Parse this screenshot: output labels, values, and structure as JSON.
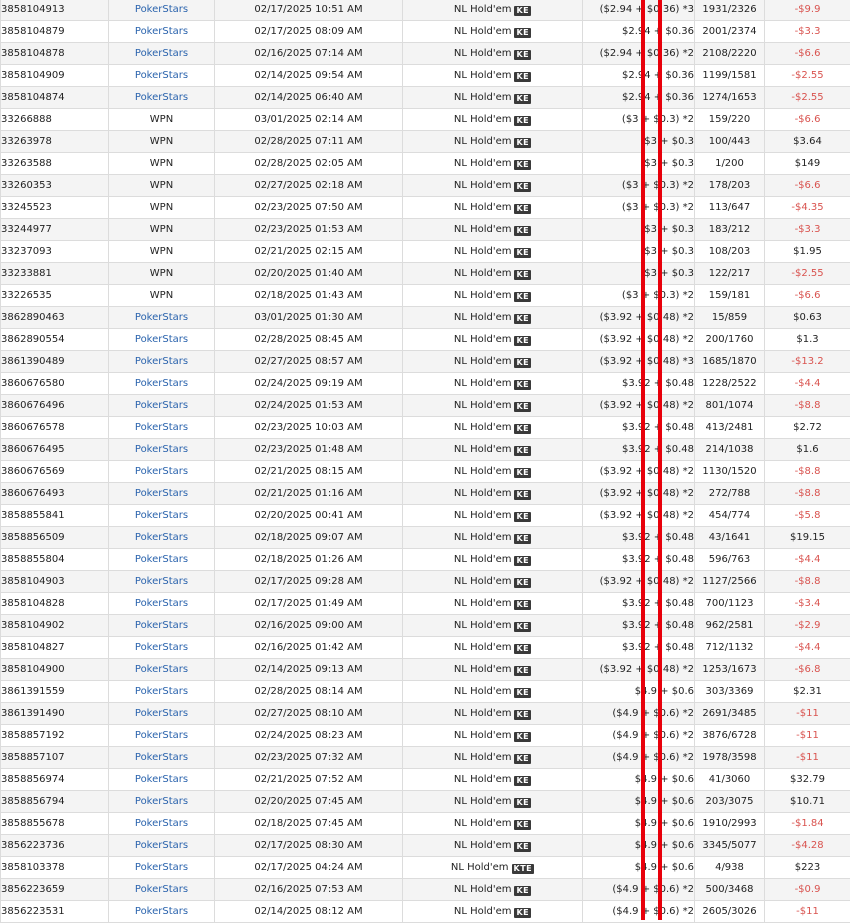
{
  "colors": {
    "site_link": "#2a63ad",
    "negative": "#d9534f",
    "marker": "#e8000b",
    "row_alt": "#f4f4f4",
    "badge_bg": "#3a3a3a"
  },
  "rows": [
    {
      "id": "3858104913",
      "site": "PokerStars",
      "date": "02/17/2025 10:51 AM",
      "game": "NL Hold'em",
      "badge": "KE",
      "buyin": "($2.94 + $0.36) *3",
      "place": "1931/2326",
      "result": "-$9.9",
      "neg": true
    },
    {
      "id": "3858104879",
      "site": "PokerStars",
      "date": "02/17/2025 08:09 AM",
      "game": "NL Hold'em",
      "badge": "KE",
      "buyin": "$2.94 + $0.36",
      "place": "2001/2374",
      "result": "-$3.3",
      "neg": true
    },
    {
      "id": "3858104878",
      "site": "PokerStars",
      "date": "02/16/2025 07:14 AM",
      "game": "NL Hold'em",
      "badge": "KE",
      "buyin": "($2.94 + $0.36) *2",
      "place": "2108/2220",
      "result": "-$6.6",
      "neg": true
    },
    {
      "id": "3858104909",
      "site": "PokerStars",
      "date": "02/14/2025 09:54 AM",
      "game": "NL Hold'em",
      "badge": "KE",
      "buyin": "$2.94 + $0.36",
      "place": "1199/1581",
      "result": "-$2.55",
      "neg": true
    },
    {
      "id": "3858104874",
      "site": "PokerStars",
      "date": "02/14/2025 06:40 AM",
      "game": "NL Hold'em",
      "badge": "KE",
      "buyin": "$2.94 + $0.36",
      "place": "1274/1653",
      "result": "-$2.55",
      "neg": true
    },
    {
      "id": "33266888",
      "site": "WPN",
      "date": "03/01/2025 02:14 AM",
      "game": "NL Hold'em",
      "badge": "KE",
      "buyin": "($3 + $0.3) *2",
      "place": "159/220",
      "result": "-$6.6",
      "neg": true
    },
    {
      "id": "33263978",
      "site": "WPN",
      "date": "02/28/2025 07:11 AM",
      "game": "NL Hold'em",
      "badge": "KE",
      "buyin": "$3 + $0.3",
      "place": "100/443",
      "result": "$3.64",
      "neg": false
    },
    {
      "id": "33263588",
      "site": "WPN",
      "date": "02/28/2025 02:05 AM",
      "game": "NL Hold'em",
      "badge": "KE",
      "buyin": "$3 + $0.3",
      "place": "1/200",
      "result": "$149",
      "neg": false
    },
    {
      "id": "33260353",
      "site": "WPN",
      "date": "02/27/2025 02:18 AM",
      "game": "NL Hold'em",
      "badge": "KE",
      "buyin": "($3 + $0.3) *2",
      "place": "178/203",
      "result": "-$6.6",
      "neg": true
    },
    {
      "id": "33245523",
      "site": "WPN",
      "date": "02/23/2025 07:50 AM",
      "game": "NL Hold'em",
      "badge": "KE",
      "buyin": "($3 + $0.3) *2",
      "place": "113/647",
      "result": "-$4.35",
      "neg": true
    },
    {
      "id": "33244977",
      "site": "WPN",
      "date": "02/23/2025 01:53 AM",
      "game": "NL Hold'em",
      "badge": "KE",
      "buyin": "$3 + $0.3",
      "place": "183/212",
      "result": "-$3.3",
      "neg": true
    },
    {
      "id": "33237093",
      "site": "WPN",
      "date": "02/21/2025 02:15 AM",
      "game": "NL Hold'em",
      "badge": "KE",
      "buyin": "$3 + $0.3",
      "place": "108/203",
      "result": "$1.95",
      "neg": false
    },
    {
      "id": "33233881",
      "site": "WPN",
      "date": "02/20/2025 01:40 AM",
      "game": "NL Hold'em",
      "badge": "KE",
      "buyin": "$3 + $0.3",
      "place": "122/217",
      "result": "-$2.55",
      "neg": true
    },
    {
      "id": "33226535",
      "site": "WPN",
      "date": "02/18/2025 01:43 AM",
      "game": "NL Hold'em",
      "badge": "KE",
      "buyin": "($3 + $0.3) *2",
      "place": "159/181",
      "result": "-$6.6",
      "neg": true
    },
    {
      "id": "3862890463",
      "site": "PokerStars",
      "date": "03/01/2025 01:30 AM",
      "game": "NL Hold'em",
      "badge": "KE",
      "buyin": "($3.92 + $0.48) *2",
      "place": "15/859",
      "result": "$0.63",
      "neg": false
    },
    {
      "id": "3862890554",
      "site": "PokerStars",
      "date": "02/28/2025 08:45 AM",
      "game": "NL Hold'em",
      "badge": "KE",
      "buyin": "($3.92 + $0.48) *2",
      "place": "200/1760",
      "result": "$1.3",
      "neg": false
    },
    {
      "id": "3861390489",
      "site": "PokerStars",
      "date": "02/27/2025 08:57 AM",
      "game": "NL Hold'em",
      "badge": "KE",
      "buyin": "($3.92 + $0.48) *3",
      "place": "1685/1870",
      "result": "-$13.2",
      "neg": true
    },
    {
      "id": "3860676580",
      "site": "PokerStars",
      "date": "02/24/2025 09:19 AM",
      "game": "NL Hold'em",
      "badge": "KE",
      "buyin": "$3.92 + $0.48",
      "place": "1228/2522",
      "result": "-$4.4",
      "neg": true
    },
    {
      "id": "3860676496",
      "site": "PokerStars",
      "date": "02/24/2025 01:53 AM",
      "game": "NL Hold'em",
      "badge": "KE",
      "buyin": "($3.92 + $0.48) *2",
      "place": "801/1074",
      "result": "-$8.8",
      "neg": true
    },
    {
      "id": "3860676578",
      "site": "PokerStars",
      "date": "02/23/2025 10:03 AM",
      "game": "NL Hold'em",
      "badge": "KE",
      "buyin": "$3.92 + $0.48",
      "place": "413/2481",
      "result": "$2.72",
      "neg": false
    },
    {
      "id": "3860676495",
      "site": "PokerStars",
      "date": "02/23/2025 01:48 AM",
      "game": "NL Hold'em",
      "badge": "KE",
      "buyin": "$3.92 + $0.48",
      "place": "214/1038",
      "result": "$1.6",
      "neg": false
    },
    {
      "id": "3860676569",
      "site": "PokerStars",
      "date": "02/21/2025 08:15 AM",
      "game": "NL Hold'em",
      "badge": "KE",
      "buyin": "($3.92 + $0.48) *2",
      "place": "1130/1520",
      "result": "-$8.8",
      "neg": true
    },
    {
      "id": "3860676493",
      "site": "PokerStars",
      "date": "02/21/2025 01:16 AM",
      "game": "NL Hold'em",
      "badge": "KE",
      "buyin": "($3.92 + $0.48) *2",
      "place": "272/788",
      "result": "-$8.8",
      "neg": true
    },
    {
      "id": "3858855841",
      "site": "PokerStars",
      "date": "02/20/2025 00:41 AM",
      "game": "NL Hold'em",
      "badge": "KE",
      "buyin": "($3.92 + $0.48) *2",
      "place": "454/774",
      "result": "-$5.8",
      "neg": true
    },
    {
      "id": "3858856509",
      "site": "PokerStars",
      "date": "02/18/2025 09:07 AM",
      "game": "NL Hold'em",
      "badge": "KE",
      "buyin": "$3.92 + $0.48",
      "place": "43/1641",
      "result": "$19.15",
      "neg": false
    },
    {
      "id": "3858855804",
      "site": "PokerStars",
      "date": "02/18/2025 01:26 AM",
      "game": "NL Hold'em",
      "badge": "KE",
      "buyin": "$3.92 + $0.48",
      "place": "596/763",
      "result": "-$4.4",
      "neg": true
    },
    {
      "id": "3858104903",
      "site": "PokerStars",
      "date": "02/17/2025 09:28 AM",
      "game": "NL Hold'em",
      "badge": "KE",
      "buyin": "($3.92 + $0.48) *2",
      "place": "1127/2566",
      "result": "-$8.8",
      "neg": true
    },
    {
      "id": "3858104828",
      "site": "PokerStars",
      "date": "02/17/2025 01:49 AM",
      "game": "NL Hold'em",
      "badge": "KE",
      "buyin": "$3.92 + $0.48",
      "place": "700/1123",
      "result": "-$3.4",
      "neg": true
    },
    {
      "id": "3858104902",
      "site": "PokerStars",
      "date": "02/16/2025 09:00 AM",
      "game": "NL Hold'em",
      "badge": "KE",
      "buyin": "$3.92 + $0.48",
      "place": "962/2581",
      "result": "-$2.9",
      "neg": true
    },
    {
      "id": "3858104827",
      "site": "PokerStars",
      "date": "02/16/2025 01:42 AM",
      "game": "NL Hold'em",
      "badge": "KE",
      "buyin": "$3.92 + $0.48",
      "place": "712/1132",
      "result": "-$4.4",
      "neg": true
    },
    {
      "id": "3858104900",
      "site": "PokerStars",
      "date": "02/14/2025 09:13 AM",
      "game": "NL Hold'em",
      "badge": "KE",
      "buyin": "($3.92 + $0.48) *2",
      "place": "1253/1673",
      "result": "-$6.8",
      "neg": true
    },
    {
      "id": "3861391559",
      "site": "PokerStars",
      "date": "02/28/2025 08:14 AM",
      "game": "NL Hold'em",
      "badge": "KE",
      "buyin": "$4.9 + $0.6",
      "place": "303/3369",
      "result": "$2.31",
      "neg": false
    },
    {
      "id": "3861391490",
      "site": "PokerStars",
      "date": "02/27/2025 08:10 AM",
      "game": "NL Hold'em",
      "badge": "KE",
      "buyin": "($4.9 + $0.6) *2",
      "place": "2691/3485",
      "result": "-$11",
      "neg": true
    },
    {
      "id": "3858857192",
      "site": "PokerStars",
      "date": "02/24/2025 08:23 AM",
      "game": "NL Hold'em",
      "badge": "KE",
      "buyin": "($4.9 + $0.6) *2",
      "place": "3876/6728",
      "result": "-$11",
      "neg": true
    },
    {
      "id": "3858857107",
      "site": "PokerStars",
      "date": "02/23/2025 07:32 AM",
      "game": "NL Hold'em",
      "badge": "KE",
      "buyin": "($4.9 + $0.6) *2",
      "place": "1978/3598",
      "result": "-$11",
      "neg": true
    },
    {
      "id": "3858856974",
      "site": "PokerStars",
      "date": "02/21/2025 07:52 AM",
      "game": "NL Hold'em",
      "badge": "KE",
      "buyin": "$4.9 + $0.6",
      "place": "41/3060",
      "result": "$32.79",
      "neg": false
    },
    {
      "id": "3858856794",
      "site": "PokerStars",
      "date": "02/20/2025 07:45 AM",
      "game": "NL Hold'em",
      "badge": "KE",
      "buyin": "$4.9 + $0.6",
      "place": "203/3075",
      "result": "$10.71",
      "neg": false
    },
    {
      "id": "3858855678",
      "site": "PokerStars",
      "date": "02/18/2025 07:45 AM",
      "game": "NL Hold'em",
      "badge": "KE",
      "buyin": "$4.9 + $0.6",
      "place": "1910/2993",
      "result": "-$1.84",
      "neg": true
    },
    {
      "id": "3856223736",
      "site": "PokerStars",
      "date": "02/17/2025 08:30 AM",
      "game": "NL Hold'em",
      "badge": "KE",
      "buyin": "$4.9 + $0.6",
      "place": "3345/5077",
      "result": "-$4.28",
      "neg": true
    },
    {
      "id": "3858103378",
      "site": "PokerStars",
      "date": "02/17/2025 04:24 AM",
      "game": "NL Hold'em",
      "badge": "KTE",
      "buyin": "$4.9 + $0.6",
      "place": "4/938",
      "result": "$223",
      "neg": false
    },
    {
      "id": "3856223659",
      "site": "PokerStars",
      "date": "02/16/2025 07:53 AM",
      "game": "NL Hold'em",
      "badge": "KE",
      "buyin": "($4.9 + $0.6) *2",
      "place": "500/3468",
      "result": "-$0.9",
      "neg": true
    },
    {
      "id": "3856223531",
      "site": "PokerStars",
      "date": "02/14/2025 08:12 AM",
      "game": "NL Hold'em",
      "badge": "KE",
      "buyin": "($4.9 + $0.6) *2",
      "place": "2605/3026",
      "result": "-$11",
      "neg": true
    }
  ]
}
